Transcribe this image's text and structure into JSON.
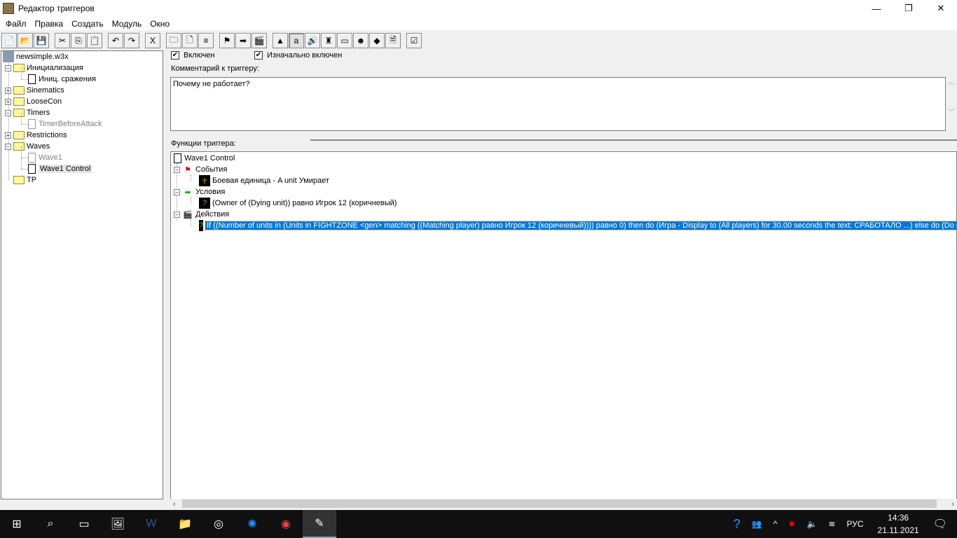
{
  "window": {
    "title": "Редактор триггеров",
    "minimize": "—",
    "maximize": "❐",
    "close": "✕"
  },
  "menu": [
    "Файл",
    "Правка",
    "Создать",
    "Модуль",
    "Окно"
  ],
  "toolbar": [
    {
      "icon": "new-icon",
      "g": "📄"
    },
    {
      "icon": "open-icon",
      "g": "📂"
    },
    {
      "icon": "save-icon",
      "g": "💾"
    },
    {
      "sep": true
    },
    {
      "icon": "cut-icon",
      "g": "✂"
    },
    {
      "icon": "copy-icon",
      "g": "⎘"
    },
    {
      "icon": "paste-icon",
      "g": "📋"
    },
    {
      "sep": true
    },
    {
      "icon": "undo-icon",
      "g": "↶"
    },
    {
      "icon": "redo-icon",
      "g": "↷"
    },
    {
      "sep": true
    },
    {
      "icon": "delete-icon",
      "g": "X"
    },
    {
      "sep": true
    },
    {
      "icon": "new-category-icon",
      "g": "🗀"
    },
    {
      "icon": "new-trigger-icon",
      "g": "🗋"
    },
    {
      "icon": "new-comment-icon",
      "g": "≡"
    },
    {
      "sep": true
    },
    {
      "icon": "event-icon",
      "g": "⚑"
    },
    {
      "icon": "condition-icon",
      "g": "➡"
    },
    {
      "icon": "action-icon",
      "g": "🎬"
    },
    {
      "sep": true
    },
    {
      "icon": "terrain-editor-icon",
      "g": "▲"
    },
    {
      "icon": "trigger-editor-icon",
      "g": "a",
      "active": true
    },
    {
      "icon": "sound-editor-icon",
      "g": "🔊"
    },
    {
      "icon": "object-editor-icon",
      "g": "♜"
    },
    {
      "icon": "campaign-editor-icon",
      "g": "▭"
    },
    {
      "icon": "ai-editor-icon",
      "g": "☻"
    },
    {
      "icon": "import-manager-icon",
      "g": "◆"
    },
    {
      "icon": "test-map-icon",
      "g": "🗎"
    },
    {
      "sep": true
    },
    {
      "icon": "validate-icon",
      "g": "☑"
    }
  ],
  "tree": {
    "root": "newsimple.w3x",
    "items": [
      {
        "label": "Инициализация",
        "type": "folder",
        "level": 1,
        "exp": "−"
      },
      {
        "label": "Иниц. сражения",
        "type": "doc",
        "level": 2
      },
      {
        "label": "Sinematics",
        "type": "folder",
        "level": 1,
        "exp": "+"
      },
      {
        "label": "LooseCon",
        "type": "folder",
        "level": 1,
        "exp": "+"
      },
      {
        "label": "Timers",
        "type": "folder",
        "level": 1,
        "exp": "−"
      },
      {
        "label": "TimerBeforeAttack",
        "type": "doc",
        "level": 2,
        "disabled": true
      },
      {
        "label": "Restrictions",
        "type": "folder",
        "level": 1,
        "exp": "+"
      },
      {
        "label": "Waves",
        "type": "folder",
        "level": 1,
        "exp": "−"
      },
      {
        "label": "Wave1",
        "type": "doc",
        "level": 2,
        "disabled": true
      },
      {
        "label": "Wave1 Control",
        "type": "doc",
        "level": 2,
        "selected": true
      },
      {
        "label": "TP",
        "type": "folder",
        "level": 1
      }
    ]
  },
  "trigger": {
    "enabled_label": "Включен",
    "initially_on_label": "Изначально включен",
    "comment_label": "Комментарий к триггеру:",
    "comment": "Почему не работает?",
    "functions_label": "Функции триггера:",
    "name": "Wave1 Control",
    "events_label": "События",
    "event": "Боевая единица - A unit Умирает",
    "conditions_label": "Условия",
    "condition": "(Owner of (Dying unit)) равно Игрок 12 (коричневый)",
    "actions_label": "Действия",
    "action": "If ((Number of units in (Units in FIGHTZONE <gen> matching ((Matching player) равно Игрок 12 (коричневый)))) равно 0) then do (Игра - Display to (All players) for 30.00 seconds the text: СРАБОТАЛО ...) else do (Do nothing)"
  },
  "taskbar": {
    "lang": "РУС",
    "time": "14:36",
    "date": "21.11.2021"
  },
  "colors": {
    "selection": "#0078d7",
    "taskbar": "#101010"
  }
}
